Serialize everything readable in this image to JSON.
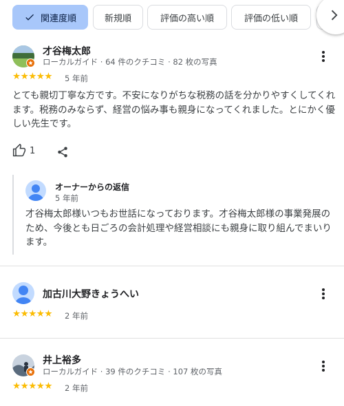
{
  "sort_chips": [
    "関連度順",
    "新規順",
    "評価の高い順",
    "評価の低い順"
  ],
  "icons": {
    "check": "check-icon",
    "next": "chevron-right-icon",
    "like": "thumbs-up-icon",
    "share": "share-icon",
    "more": "more-vert-icon",
    "guide_badge": "star-badge-icon"
  },
  "colors": {
    "selected_chip": "#a8c7fa",
    "stars": "#fbbc04",
    "badge": "#e8710a",
    "avatar_blue": "#4285f4"
  },
  "reviews": [
    {
      "name": "才谷梅太郎",
      "meta": "ローカルガイド · 64 件のクチコミ · 82 枚の写真",
      "stars": "★★★★★",
      "rating": 5,
      "time": "5 年前",
      "text": "とても親切丁寧な方です。不安になりがちな税務の話を分かりやすくしてくれます。税務のみならず、経営の悩み事も親身になってくれました。とにかく優しい先生です。",
      "likes": "1",
      "owner_reply": {
        "title": "オーナーからの返信",
        "time": "5 年前",
        "text": "才谷梅太郎様いつもお世話になっております。才谷梅太郎様の事業発展のため、今後とも日ごろの会計処理や経営相談にも親身に取り組んでまいります。"
      }
    },
    {
      "name": "加古川大野きょうへい",
      "stars": "★★★★★",
      "rating": 5,
      "time": "2 年前"
    },
    {
      "name": "井上裕多",
      "meta": "ローカルガイド · 39 件のクチコミ · 107 枚の写真",
      "stars": "★★★★★",
      "rating": 5,
      "time": "2 年前"
    }
  ]
}
